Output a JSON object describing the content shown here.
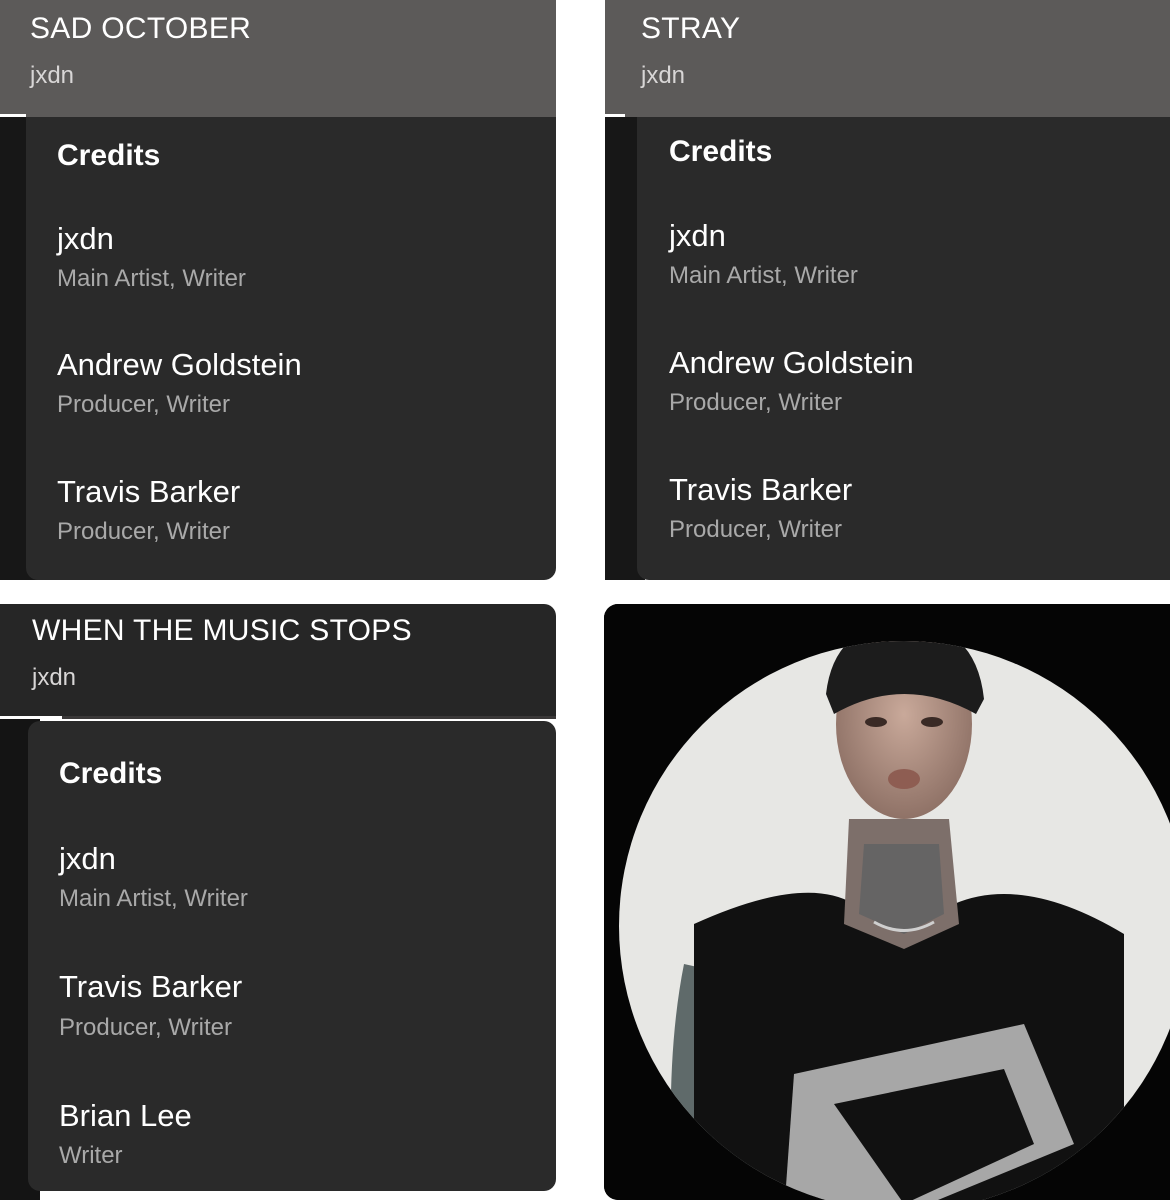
{
  "panels": [
    {
      "title": "SAD OCTOBER",
      "artist": "jxdn",
      "credits_heading": "Credits",
      "credits": [
        {
          "name": "jxdn",
          "role": "Main Artist, Writer"
        },
        {
          "name": "Andrew Goldstein",
          "role": "Producer, Writer"
        },
        {
          "name": "Travis Barker",
          "role": "Producer, Writer"
        }
      ]
    },
    {
      "title": "STRAY",
      "artist": "jxdn",
      "credits_heading": "Credits",
      "credits": [
        {
          "name": "jxdn",
          "role": "Main Artist, Writer"
        },
        {
          "name": "Andrew Goldstein",
          "role": "Producer, Writer"
        },
        {
          "name": "Travis Barker",
          "role": "Producer, Writer"
        }
      ]
    },
    {
      "title": "WHEN THE MUSIC STOPS",
      "artist": "jxdn",
      "credits_heading": "Credits",
      "credits": [
        {
          "name": "jxdn",
          "role": "Main Artist, Writer"
        },
        {
          "name": "Travis Barker",
          "role": "Producer, Writer"
        },
        {
          "name": "Brian Lee",
          "role": "Writer"
        }
      ]
    }
  ],
  "colors": {
    "header_gray": "#5c5a59",
    "header_dark": "#262626",
    "card": "#2a2a2a",
    "role_text": "#a9a9a9"
  }
}
